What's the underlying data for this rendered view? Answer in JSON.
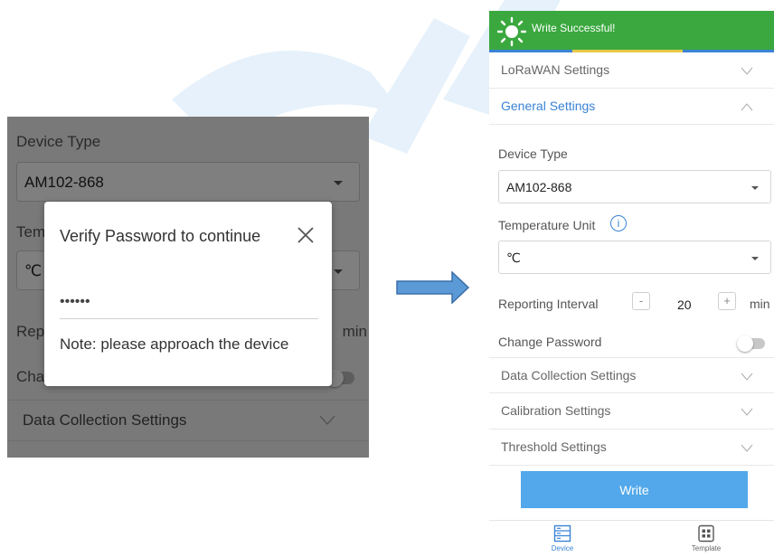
{
  "left": {
    "device_type_label": "Device Type",
    "device_type_value": "AM102-868",
    "temperature_label_partial": "Tem",
    "unit_value": "℃",
    "reporting_label_partial": "Rep",
    "reporting_unit": "min",
    "change_password_partial": "Cha",
    "data_collection": "Data Collection Settings",
    "dialog": {
      "title": "Verify Password to continue",
      "password": "••••••",
      "note": "Note: please approach the device"
    }
  },
  "right": {
    "toast": {
      "message": "Write Successful!"
    },
    "sections": {
      "lorawan": "LoRaWAN Settings",
      "general": "General Settings",
      "data_collection": "Data Collection Settings",
      "calibration": "Calibration Settings",
      "threshold": "Threshold Settings"
    },
    "device_type": {
      "label": "Device Type",
      "value": "AM102-868"
    },
    "temperature_unit": {
      "label": "Temperature Unit",
      "value": "℃",
      "info": "i"
    },
    "reporting_interval": {
      "label": "Reporting Interval",
      "minus": "-",
      "value": "20",
      "plus": "+",
      "unit": "min"
    },
    "change_password": {
      "label": "Change Password"
    },
    "write_button": "Write",
    "tabs": {
      "device": "Device",
      "template": "Template"
    }
  },
  "colors": {
    "accent": "#3a83d6",
    "success": "#3aa83e",
    "button": "#52a8ea",
    "highlight": "#e8c94a"
  },
  "icons": [
    "sun-icon",
    "chevron-down-icon",
    "chevron-up-icon",
    "info-icon",
    "close-icon",
    "device-icon",
    "template-icon",
    "arrow-right-icon"
  ]
}
